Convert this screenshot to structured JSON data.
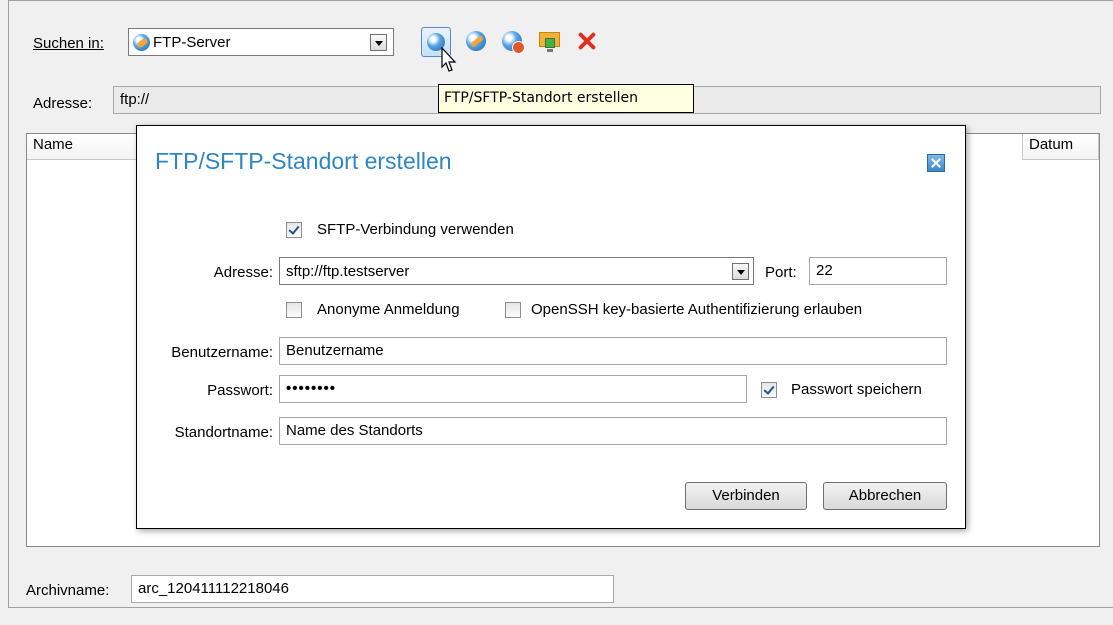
{
  "toolbar": {
    "search_in_label": "Suchen in:",
    "location_value": "FTP-Server",
    "icons": [
      "ftp-location-icon",
      "connect-icon",
      "disconnect-icon",
      "add-location-icon",
      "delete-icon"
    ]
  },
  "address_bar": {
    "label": "Adresse:",
    "value": "ftp://"
  },
  "tooltip": "FTP/SFTP-Standort erstellen",
  "list": {
    "columns": [
      "Name",
      "Datum"
    ]
  },
  "dialog": {
    "title": "FTP/SFTP-Standort erstellen",
    "sftp_checkbox_label": "SFTP-Verbindung verwenden",
    "sftp_checked": true,
    "address_label": "Adresse:",
    "address_value": "sftp://ftp.testserver",
    "port_label": "Port:",
    "port_value": "22",
    "anonymous_label": "Anonyme Anmeldung",
    "anonymous_checked": false,
    "openssh_label": "OpenSSH key-basierte Authentifizierung erlauben",
    "openssh_checked": false,
    "username_label": "Benutzername:",
    "username_value": "Benutzername",
    "password_label": "Passwort:",
    "password_value": "••••••••",
    "save_password_label": "Passwort speichern",
    "save_password_checked": true,
    "location_name_label": "Standortname:",
    "location_name_value": "Name des Standorts",
    "connect_button": "Verbinden",
    "cancel_button": "Abbrechen"
  },
  "archive": {
    "label": "Archivname:",
    "value": "arc_120411112218046"
  },
  "colors": {
    "dialog_title": "#2e86c8",
    "tooltip_bg": "#ffffe1",
    "window_bg": "#f0f0f0"
  }
}
